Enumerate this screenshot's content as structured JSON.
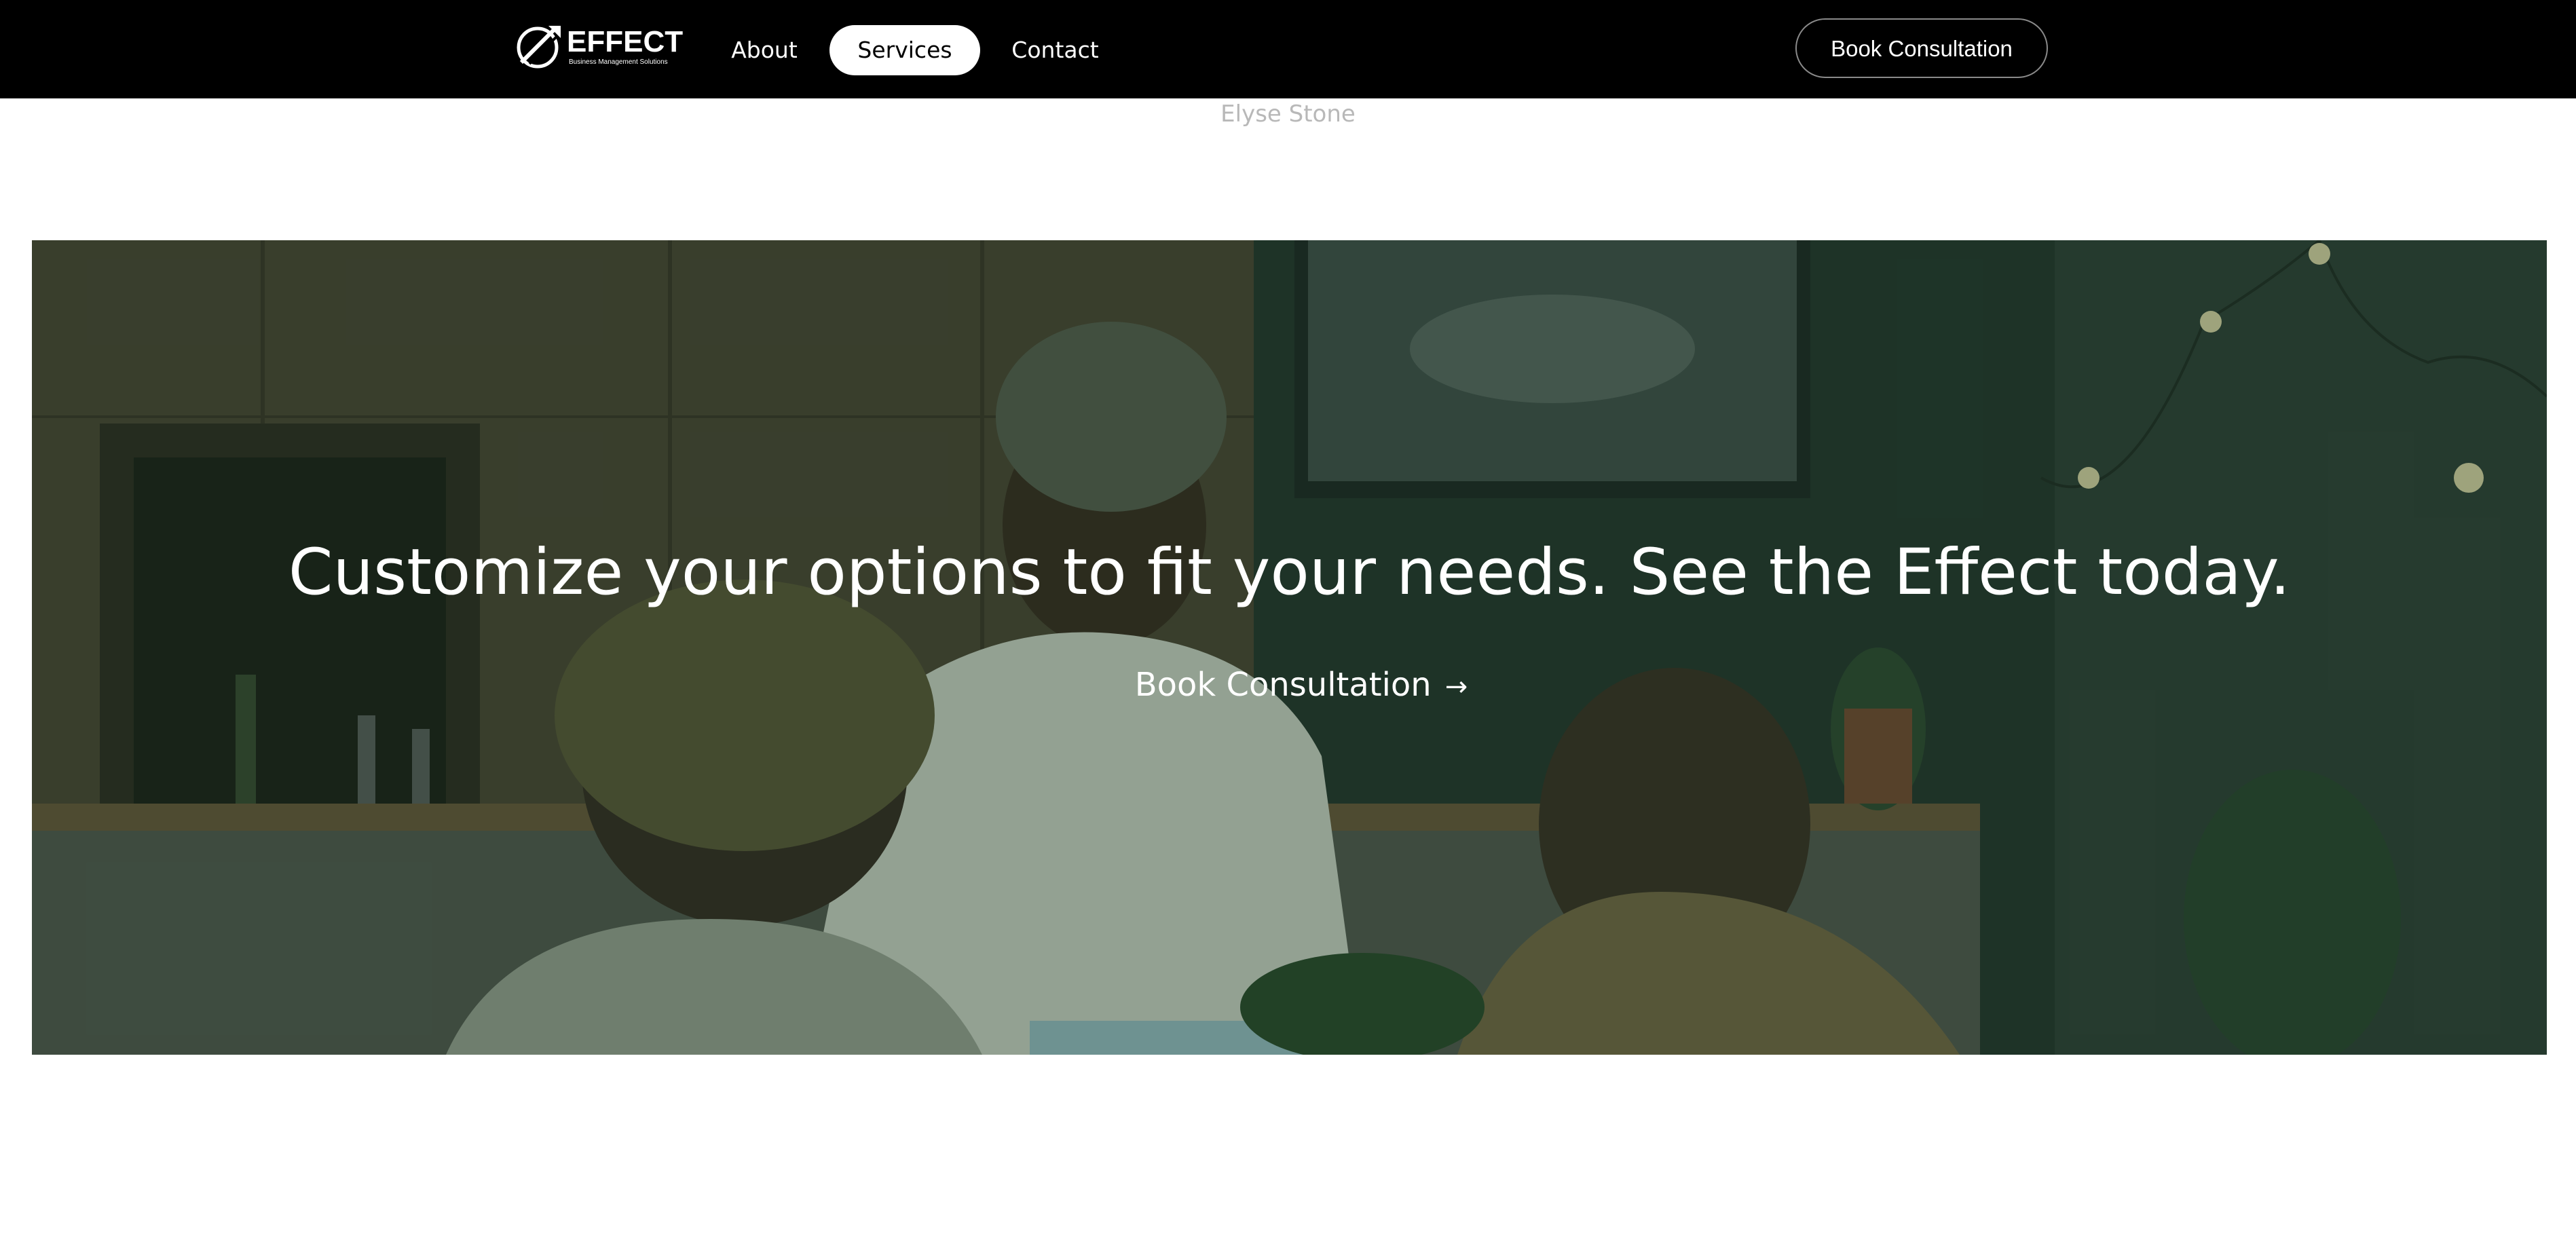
{
  "nav": {
    "logo": {
      "word": "EFFECT",
      "tagline": "Business Management Solutions",
      "icon": "effect-logo-icon"
    },
    "links": [
      {
        "label": "About"
      },
      {
        "label": "Services",
        "active": true
      },
      {
        "label": "Contact"
      }
    ],
    "cta_label": "Book Consultation"
  },
  "author": {
    "name": "Elyse Stone"
  },
  "hero": {
    "headline": "Customize your options to fit your needs. See the Effect today.",
    "cta_label": "Book Consultation",
    "cta_icon": "arrow-right-icon"
  },
  "colors": {
    "nav_bg": "#000000",
    "accent_overlay": "#1e3c28",
    "author_text": "#b8b8b8"
  }
}
